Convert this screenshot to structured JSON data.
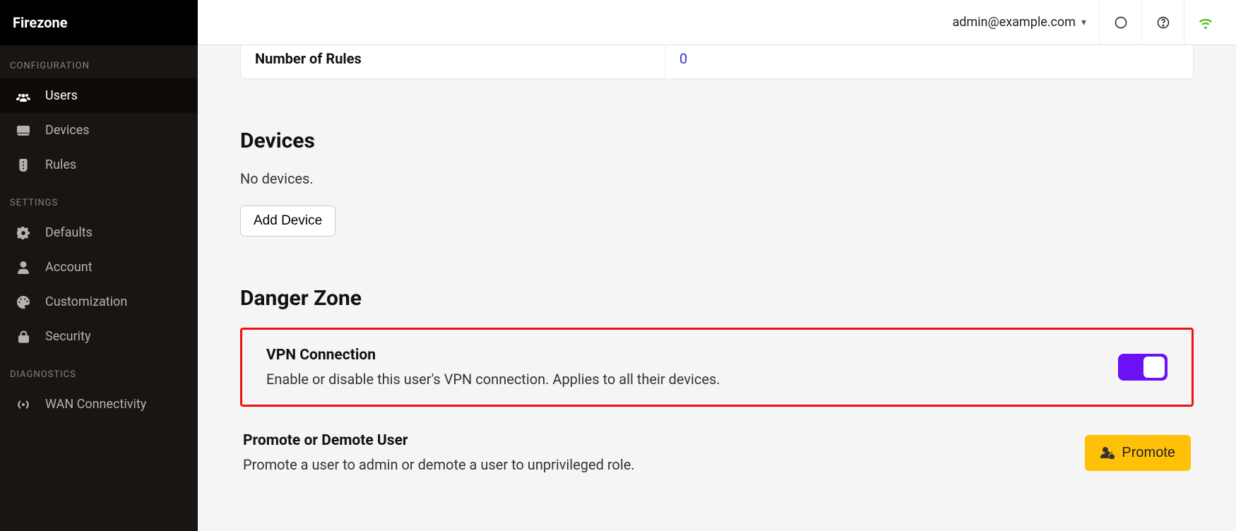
{
  "brand": "Firezone",
  "sidebar": {
    "sections": [
      {
        "label": "CONFIGURATION"
      },
      {
        "label": "SETTINGS"
      },
      {
        "label": "DIAGNOSTICS"
      }
    ],
    "items": {
      "users": "Users",
      "devices": "Devices",
      "rules": "Rules",
      "defaults": "Defaults",
      "account": "Account",
      "customization": "Customization",
      "security": "Security",
      "wan": "WAN Connectivity"
    }
  },
  "topbar": {
    "user_email": "admin@example.com"
  },
  "info": {
    "rules_label": "Number of Rules",
    "rules_value": "0"
  },
  "devices": {
    "heading": "Devices",
    "empty_text": "No devices.",
    "add_button": "Add Device"
  },
  "danger": {
    "heading": "Danger Zone",
    "vpn_title": "VPN Connection",
    "vpn_desc": "Enable or disable this user's VPN connection. Applies to all their devices.",
    "vpn_enabled": true,
    "promote_title": "Promote or Demote User",
    "promote_desc": "Promote a user to admin or demote a user to unprivileged role.",
    "promote_button": "Promote"
  }
}
